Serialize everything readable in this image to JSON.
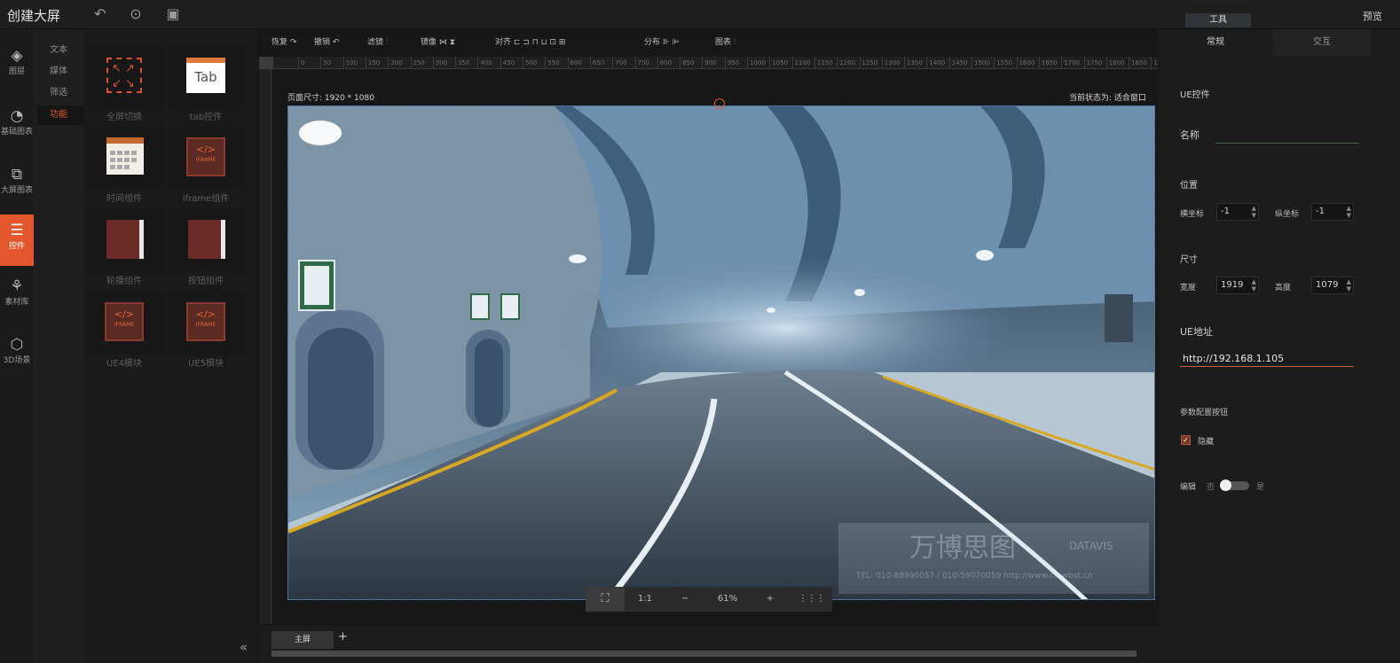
{
  "app": {
    "title": "创建大屏",
    "preview_label": "预览",
    "tools_label": "工具"
  },
  "left_nav": [
    {
      "label": "图层",
      "icon": "layers-icon"
    },
    {
      "label": "基础图表",
      "icon": "pie-chart-icon"
    },
    {
      "label": "大屏图表",
      "icon": "screen-chart-icon"
    },
    {
      "label": "控件",
      "icon": "sliders-icon"
    },
    {
      "label": "素材库",
      "icon": "assets-icon"
    },
    {
      "label": "3D场景",
      "icon": "cube-icon"
    }
  ],
  "sub_nav": [
    "文本",
    "媒体",
    "筛选",
    "功能"
  ],
  "components": [
    {
      "label": "全屏切换",
      "kind": "fullscreen"
    },
    {
      "label": "tab控件",
      "kind": "tab"
    },
    {
      "label": "时间组件",
      "kind": "calendar"
    },
    {
      "label": "iframe组件",
      "kind": "iframe"
    },
    {
      "label": "轮播组件",
      "kind": "book"
    },
    {
      "label": "按钮组件",
      "kind": "book"
    },
    {
      "label": "UE4模块",
      "kind": "iframe"
    },
    {
      "label": "UE5模块",
      "kind": "iframe"
    }
  ],
  "icon_text": {
    "tab": "Tab",
    "iframe_code": "</>",
    "iframe_word": "IFRAME"
  },
  "toolbar": {
    "restore": "恢复",
    "undo": "撤销",
    "filter": "滤镜",
    "mirror": "镜像",
    "align": "对齐",
    "distribute": "分布",
    "chart": "图表"
  },
  "ruler_ticks": [
    "0",
    "50",
    "100",
    "150",
    "200",
    "250",
    "300",
    "350",
    "400",
    "450",
    "500",
    "550",
    "600",
    "650",
    "700",
    "750",
    "800",
    "850",
    "900",
    "950",
    "1000",
    "1050",
    "1100",
    "1150",
    "1200",
    "1250",
    "1300",
    "1350",
    "1400",
    "1450",
    "1500",
    "1550",
    "1600",
    "1650",
    "1700",
    "1750",
    "1800",
    "1850",
    "1900"
  ],
  "canvas": {
    "page_size": "页面尺寸: 1920 * 1080",
    "status": "当前状态为: 适合窗口",
    "watermark_brand": "万博思图",
    "watermark_brand_en": "DATAVIS",
    "watermark_contact": "TEL: 010-88990057 / 010-59070059    http://www.cn-wbst.cn"
  },
  "zoom": {
    "ratio_label": "1:1",
    "minus": "−",
    "value": "61%",
    "plus": "+"
  },
  "bottom": {
    "screen_tab": "主屏",
    "add": "+"
  },
  "right_panel": {
    "tab_general": "常规",
    "tab_interact": "交互",
    "section_title": "UE控件",
    "name_label": "名称",
    "name_value": "",
    "position_label": "位置",
    "x_label": "横坐标",
    "x_value": "-1",
    "y_label": "纵坐标",
    "y_value": "-1",
    "size_label": "尺寸",
    "width_label": "宽度",
    "width_value": "1919",
    "height_label": "高度",
    "height_value": "1079",
    "ue_address_label": "UE地址",
    "ue_address_value": "http://192.168.1.105",
    "param_label": "参数配置按钮",
    "hide_label": "隐藏",
    "hide_checked": true,
    "edit_label": "编辑",
    "edit_off": "否",
    "edit_on": "是"
  },
  "colors": {
    "accent": "#e4572e",
    "bg": "#141414",
    "panel": "#1c1c1c"
  }
}
